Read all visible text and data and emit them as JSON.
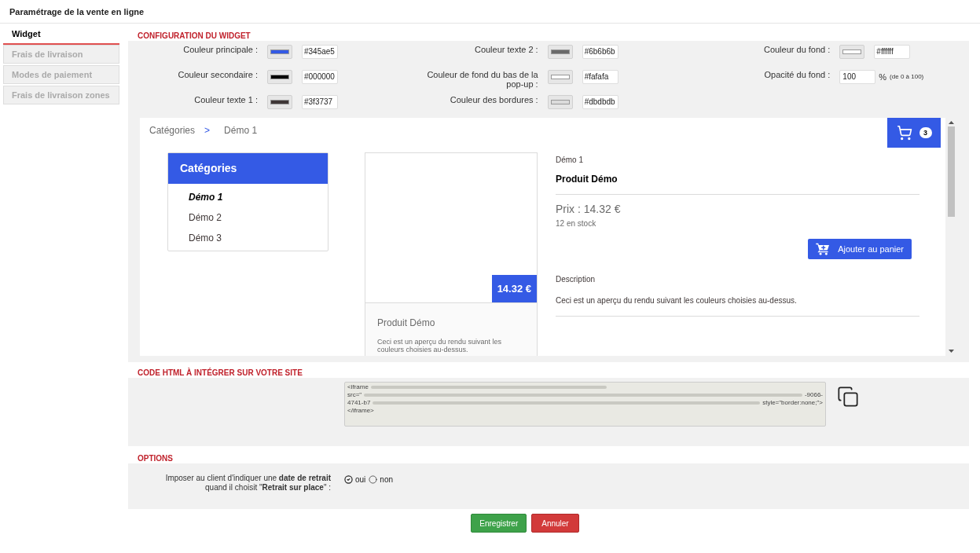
{
  "page_title": "Paramétrage de la vente en ligne",
  "tabs": [
    {
      "label": "Widget",
      "selected": true
    },
    {
      "label": "Frais de livraison",
      "selected": false
    },
    {
      "label": "Modes de paiement",
      "selected": false
    },
    {
      "label": "Frais de livraison zones",
      "selected": false
    }
  ],
  "config": {
    "heading": "CONFIGURATION DU WIDGET",
    "columns": [
      [
        {
          "kind": "color",
          "label": "Couleur principale :",
          "color": "#345ae5",
          "value": "#345ae5"
        },
        {
          "kind": "color",
          "label": "Couleur secondaire :",
          "color": "#000000",
          "value": "#000000"
        },
        {
          "kind": "color",
          "label": "Couleur texte 1 :",
          "color": "#3f3737",
          "value": "#3f3737"
        }
      ],
      [
        {
          "kind": "color",
          "label": "Couleur texte 2 :",
          "color": "#6b6b6b",
          "value": "#6b6b6b"
        },
        {
          "kind": "color",
          "label": "Couleur de fond du bas de la pop-up :",
          "color": "#fafafa",
          "value": "#fafafa"
        },
        {
          "kind": "color",
          "label": "Couleur des bordures :",
          "color": "#dbdbdb",
          "value": "#dbdbdb"
        }
      ],
      [
        {
          "kind": "color",
          "label": "Couleur du fond :",
          "color": "#ffffff",
          "value": "#ffffff"
        },
        {
          "kind": "number",
          "label": "Opacité du fond :",
          "value": "100",
          "unit": "%",
          "hint": "(de 0 à 100)"
        }
      ]
    ]
  },
  "preview": {
    "breadcrumb": [
      "Catégories",
      ">",
      "Démo 1"
    ],
    "cart_count": "3",
    "categories_title": "Catégories",
    "categories": [
      {
        "label": "Démo 1",
        "selected": true
      },
      {
        "label": "Démo 2",
        "selected": false
      },
      {
        "label": "Démo 3",
        "selected": false
      }
    ],
    "card": {
      "price": "14.32 €",
      "name": "Produit Démo",
      "text": "Ceci est un aperçu du rendu suivant les couleurs choisies au-dessus."
    },
    "detail": {
      "category": "Démo 1",
      "name": "Produit Démo",
      "price": "Prix : 14.32 €",
      "stock": "12 en stock",
      "button": "Ajouter au panier",
      "description_label": "Description",
      "description": "Ceci est un aperçu du rendu suivant les couleurs choisies au-dessus."
    }
  },
  "code": {
    "heading": "CODE HTML À INTÉGRER SUR VOTRE SITE",
    "lines": [
      {
        "start": "<iframe"
      },
      {
        "start": "src=\"",
        "end": "-9066-"
      },
      {
        "start": "4741-b7",
        "end": "style=\"border:none;\">"
      },
      {
        "start": "</iframe>"
      }
    ]
  },
  "options": {
    "heading": "OPTIONS",
    "label": "Imposer au client d'indiquer une **date de retrait** quand il choisit \"**Retrait sur place**\" :",
    "choices": [
      {
        "label": "oui",
        "selected": true
      },
      {
        "label": "non",
        "selected": false
      }
    ]
  },
  "buttons": [
    {
      "kind": "primary",
      "label": "Enregistrer"
    },
    {
      "kind": "cancel",
      "label": "Annuler"
    }
  ]
}
